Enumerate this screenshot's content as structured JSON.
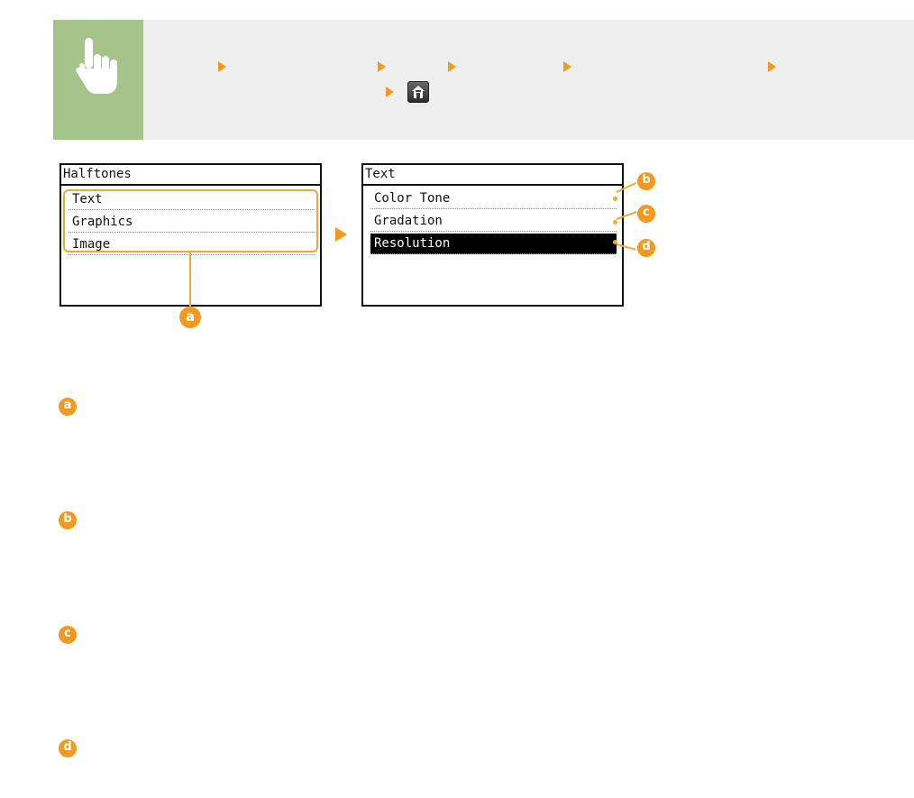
{
  "banner": {
    "hand_icon": "pointing-hand-icon",
    "home_icon": "home-icon",
    "accent_color": "#f29a1f",
    "icon_box_color": "#a6c38b"
  },
  "screen_left": {
    "title": "Halftones",
    "items": [
      "Text",
      "Graphics",
      "Image"
    ]
  },
  "screen_right": {
    "title": "Text",
    "items": [
      "Color Tone",
      "Gradation",
      "Resolution"
    ],
    "selected": "Resolution"
  },
  "callouts": {
    "a": "a",
    "b": "b",
    "c": "c",
    "d": "d"
  }
}
